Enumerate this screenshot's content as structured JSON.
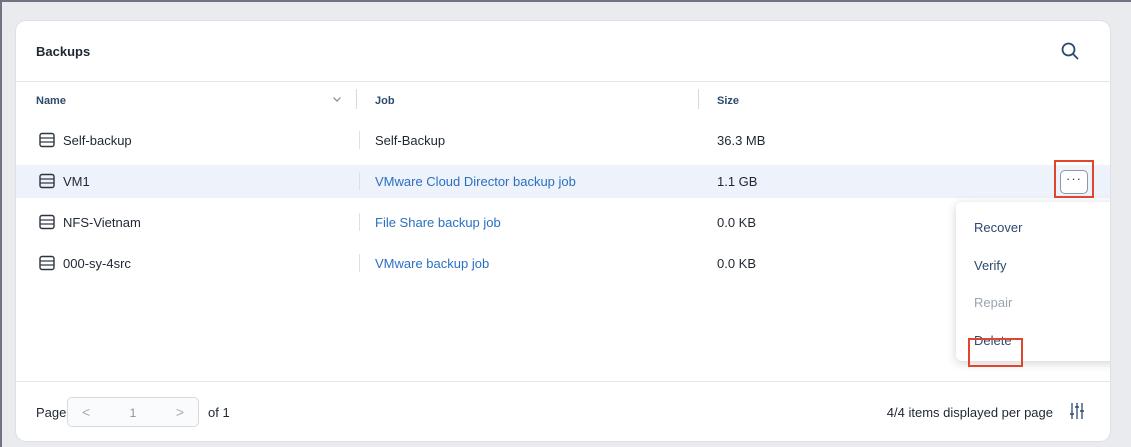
{
  "panel": {
    "title": "Backups"
  },
  "icons": {
    "search": "search-icon",
    "row": "database-icon",
    "sort": "chevron-down-icon",
    "settings": "column-settings-icon",
    "more": "more-actions-icon"
  },
  "columns": {
    "name": "Name",
    "job": "Job",
    "size": "Size"
  },
  "rows": [
    {
      "name": "Self-backup",
      "job": "Self-Backup",
      "size": "36.3 MB"
    },
    {
      "name": "VM1",
      "job": "VMware Cloud Director backup job",
      "size": "1.1 GB"
    },
    {
      "name": "NFS-Vietnam",
      "job": "File Share backup job",
      "size": "0.0 KB"
    },
    {
      "name": "000-sy-4src",
      "job": "VMware backup job",
      "size": "0.0 KB"
    }
  ],
  "row_actions": {
    "more_label": "···"
  },
  "context_menu": {
    "recover": "Recover",
    "verify": "Verify",
    "repair": "Repair",
    "delete": "Delete"
  },
  "pagination": {
    "page_label": "Page",
    "prev": "<",
    "current_page": "1",
    "next": ">",
    "of_label": "of 1"
  },
  "footer": {
    "items_per_page": "4/4 items displayed per page"
  },
  "colors": {
    "accent": "#2b6fc2",
    "highlight": "#e0452d",
    "selected_row": "#eef2fa"
  }
}
